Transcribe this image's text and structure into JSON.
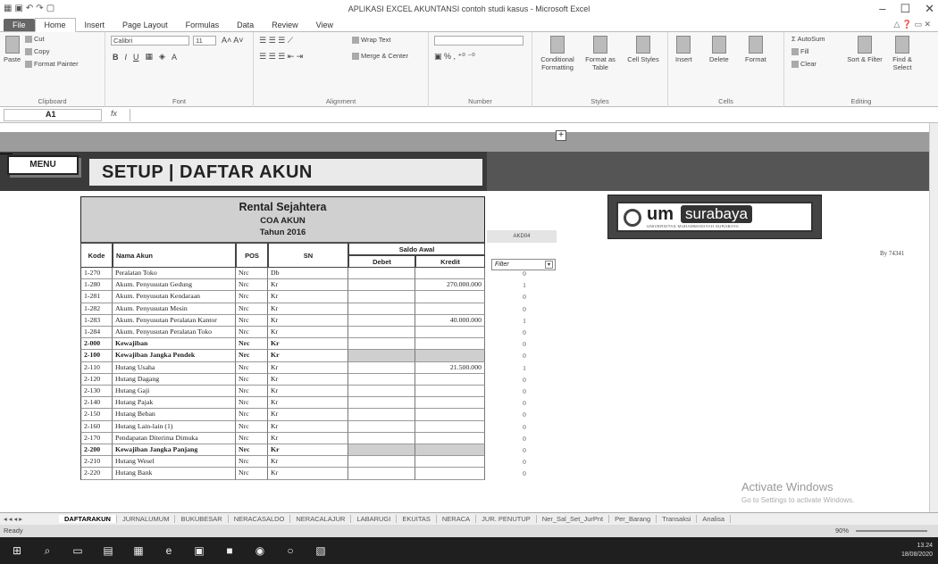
{
  "window": {
    "title": "APLIKASI EXCEL AKUNTANSI contoh studi kasus - Microsoft Excel",
    "min": "–",
    "max": "☐",
    "close": "✕"
  },
  "tabs": [
    "File",
    "Home",
    "Insert",
    "Page Layout",
    "Formulas",
    "Data",
    "Review",
    "View"
  ],
  "ribbon": {
    "clipboard": {
      "paste": "Paste",
      "cut": "Cut",
      "copy": "Copy",
      "format_painter": "Format Painter",
      "name": "Clipboard"
    },
    "font": {
      "family": "Calibri",
      "size": "11",
      "name": "Font"
    },
    "alignment": {
      "wrap": "Wrap Text",
      "merge": "Merge & Center",
      "name": "Alignment"
    },
    "number": {
      "name": "Number"
    },
    "styles": {
      "conditional": "Conditional Formatting",
      "format_table": "Format as Table",
      "cell_styles": "Cell Styles",
      "name": "Styles"
    },
    "cells": {
      "insert": "Insert",
      "delete": "Delete",
      "format": "Format",
      "name": "Cells"
    },
    "editing": {
      "autosum": "AutoSum",
      "fill": "Fill",
      "clear": "Clear",
      "sort": "Sort & Filter",
      "find": "Find & Select",
      "name": "Editing"
    }
  },
  "formula_bar": {
    "name_box": "A1",
    "fx": "fx",
    "value": ""
  },
  "sheet": {
    "menu_label": "MENU",
    "header_title": "SETUP | DAFTAR AKUN",
    "company": "Rental Sejahtera",
    "subtitle": "COA AKUN",
    "year": "Tahun 2016",
    "columns": {
      "kode": "Kode",
      "nama": "Nama Akun",
      "pos": "POS",
      "sn": "SN",
      "saldo": "Saldo Awal",
      "debet": "Debet",
      "kredit": "Kredit"
    },
    "aux_label": "AKD04",
    "filter_label": "Filter",
    "credit": "By 74341",
    "logo": {
      "um": "um",
      "city": "surabaya",
      "sub": "UNIVERSITAS MUHAMMADIYAH SURABAYA"
    },
    "rows": [
      {
        "kode": "1-270",
        "nama": "Peralatan Toko",
        "pos": "Nrc",
        "sn": "Db",
        "debet": "",
        "kredit": "",
        "flag": "0",
        "bold": false
      },
      {
        "kode": "1-280",
        "nama": "Akum. Penyusutan Gedung",
        "pos": "Nrc",
        "sn": "Kr",
        "debet": "",
        "kredit": "270.000.000",
        "flag": "1",
        "bold": false
      },
      {
        "kode": "1-281",
        "nama": "Akum. Penyusutan Kendaraan",
        "pos": "Nrc",
        "sn": "Kr",
        "debet": "",
        "kredit": "",
        "flag": "0",
        "bold": false
      },
      {
        "kode": "1-282",
        "nama": "Akum. Penyusutan Mesin",
        "pos": "Nrc",
        "sn": "Kr",
        "debet": "",
        "kredit": "",
        "flag": "0",
        "bold": false
      },
      {
        "kode": "1-283",
        "nama": "Akum. Penyusutan Peralatan Kantor",
        "pos": "Nrc",
        "sn": "Kr",
        "debet": "",
        "kredit": "40.000.000",
        "flag": "1",
        "bold": false
      },
      {
        "kode": "1-284",
        "nama": "Akum. Penyusutan Peralatan Toko",
        "pos": "Nrc",
        "sn": "Kr",
        "debet": "",
        "kredit": "",
        "flag": "0",
        "bold": false
      },
      {
        "kode": "2-000",
        "nama": "Kewajiban",
        "pos": "Nrc",
        "sn": "Kr",
        "debet": "",
        "kredit": "",
        "flag": "0",
        "bold": true
      },
      {
        "kode": "2-100",
        "nama": "Kewajiban Jangka Pendek",
        "pos": "Nrc",
        "sn": "Kr",
        "debet": "",
        "kredit": "",
        "flag": "0",
        "bold": true
      },
      {
        "kode": "2-110",
        "nama": "Hutang Usaha",
        "pos": "Nrc",
        "sn": "Kr",
        "debet": "",
        "kredit": "21.500.000",
        "flag": "1",
        "bold": false
      },
      {
        "kode": "2-120",
        "nama": "Hutang Dagang",
        "pos": "Nrc",
        "sn": "Kr",
        "debet": "",
        "kredit": "",
        "flag": "0",
        "bold": false
      },
      {
        "kode": "2-130",
        "nama": "Hutang Gaji",
        "pos": "Nrc",
        "sn": "Kr",
        "debet": "",
        "kredit": "",
        "flag": "0",
        "bold": false
      },
      {
        "kode": "2-140",
        "nama": "Hutang Pajak",
        "pos": "Nrc",
        "sn": "Kr",
        "debet": "",
        "kredit": "",
        "flag": "0",
        "bold": false
      },
      {
        "kode": "2-150",
        "nama": "Hutang Beban",
        "pos": "Nrc",
        "sn": "Kr",
        "debet": "",
        "kredit": "",
        "flag": "0",
        "bold": false
      },
      {
        "kode": "2-160",
        "nama": "Hutang Lain-lain (1)",
        "pos": "Nrc",
        "sn": "Kr",
        "debet": "",
        "kredit": "",
        "flag": "0",
        "bold": false
      },
      {
        "kode": "2-170",
        "nama": "Pendapatan Diterima Dimuka",
        "pos": "Nrc",
        "sn": "Kr",
        "debet": "",
        "kredit": "",
        "flag": "0",
        "bold": false
      },
      {
        "kode": "2-200",
        "nama": "Kewajiban Jangka Panjang",
        "pos": "Nrc",
        "sn": "Kr",
        "debet": "",
        "kredit": "",
        "flag": "0",
        "bold": true
      },
      {
        "kode": "2-210",
        "nama": "Hutang Wesel",
        "pos": "Nrc",
        "sn": "Kr",
        "debet": "",
        "kredit": "",
        "flag": "0",
        "bold": false
      },
      {
        "kode": "2-220",
        "nama": "Hutang Bank",
        "pos": "Nrc",
        "sn": "Kr",
        "debet": "",
        "kredit": "",
        "flag": "0",
        "bold": false
      }
    ],
    "activate": "Activate Windows",
    "activate_sub": "Go to Settings to activate Windows."
  },
  "sheet_tabs": [
    "DAFTARAKUN",
    "JURNALUMUM",
    "BUKUBESAR",
    "NERACASALDO",
    "NERACALAJUR",
    "LABARUGI",
    "EKUITAS",
    "NERACA",
    "JUR. PENUTUP",
    "Ner_Sal_Set_JurPnt",
    "Per_Barang",
    "Transaksi",
    "Analisa"
  ],
  "status": {
    "ready": "Ready",
    "zoom": "90%"
  },
  "clock": {
    "time": "13.24",
    "date": "18/08/2020"
  }
}
